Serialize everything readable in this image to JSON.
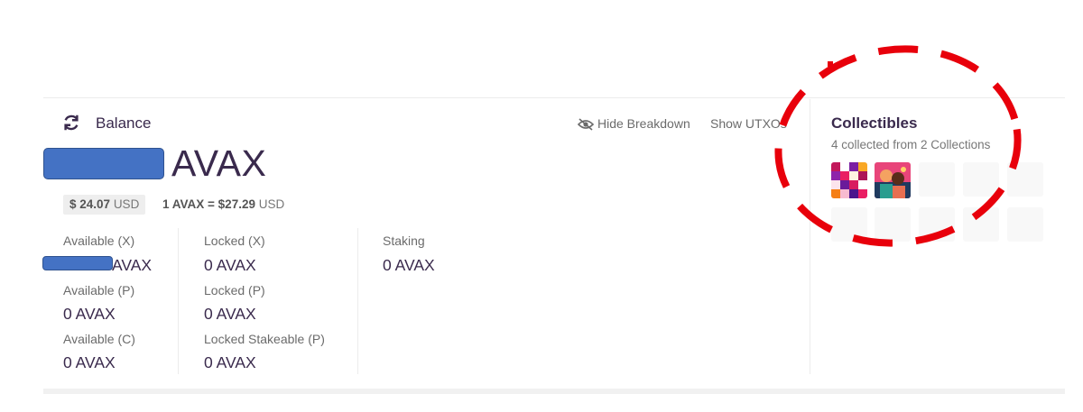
{
  "balance": {
    "refresh_icon": "refresh-icon",
    "label": "Balance",
    "unit": "AVAX",
    "usd_prefix": "$ 24.07",
    "usd_suffix": "USD",
    "rate_left": "1 AVAX =",
    "rate_value": "$27.29",
    "rate_suffix": "USD"
  },
  "actions": {
    "hide_breakdown": "Hide Breakdown",
    "show_utxos": "Show UTXOs"
  },
  "breakdown": {
    "available_x_label": "Available (X)",
    "available_x_value": "AVAX",
    "available_p_label": "Available (P)",
    "available_p_value": "0 AVAX",
    "available_c_label": "Available (C)",
    "available_c_value": "0 AVAX",
    "locked_x_label": "Locked (X)",
    "locked_x_value": "0 AVAX",
    "locked_p_label": "Locked (P)",
    "locked_p_value": "0 AVAX",
    "locked_stakeable_label": "Locked Stakeable (P)",
    "locked_stakeable_value": "0 AVAX",
    "staking_label": "Staking",
    "staking_value": "0 AVAX"
  },
  "collectibles": {
    "title": "Collectibles",
    "subtitle": "4 collected from 2 Collections"
  },
  "colors": {
    "text": "#3a2a4d",
    "muted": "#777777",
    "redaction": "#4472c4",
    "annotation": "#e8000b"
  }
}
